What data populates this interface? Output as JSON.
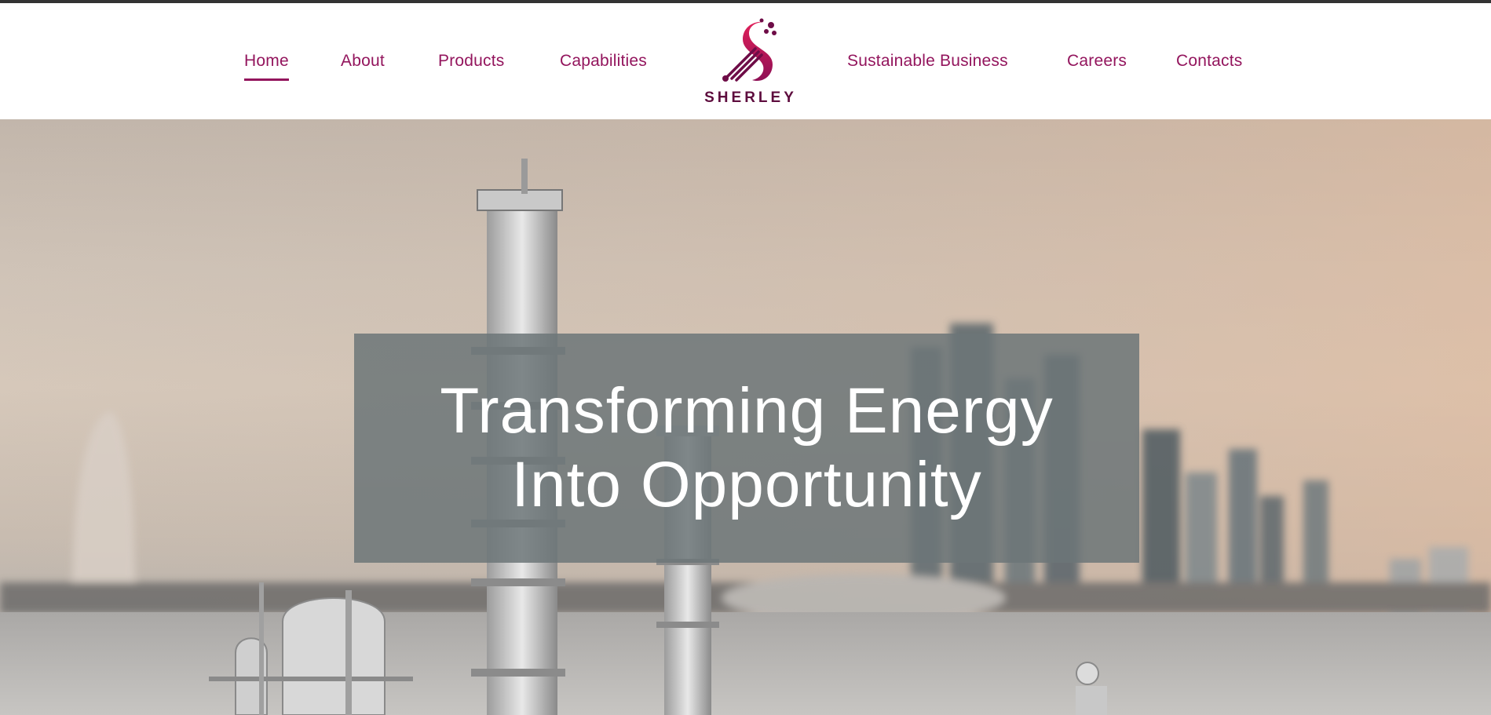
{
  "nav": {
    "left_items": [
      {
        "label": "Home",
        "active": true
      },
      {
        "label": "About",
        "active": false
      },
      {
        "label": "Products",
        "active": false
      },
      {
        "label": "Capabilities",
        "active": false
      }
    ],
    "right_items": [
      {
        "label": "Sustainable Business",
        "active": false
      },
      {
        "label": "Careers",
        "active": false
      },
      {
        "label": "Contacts",
        "active": false
      }
    ]
  },
  "logo": {
    "text": "SHERLEY",
    "icon": "sherley-logo-icon"
  },
  "hero": {
    "title_line1": "Transforming Energy",
    "title_line2": "Into Opportunity"
  },
  "colors": {
    "brand": "#93155d",
    "brand_dark": "#5e0d3e",
    "banner_overlay": "#6c7678",
    "top_border": "#333333"
  }
}
